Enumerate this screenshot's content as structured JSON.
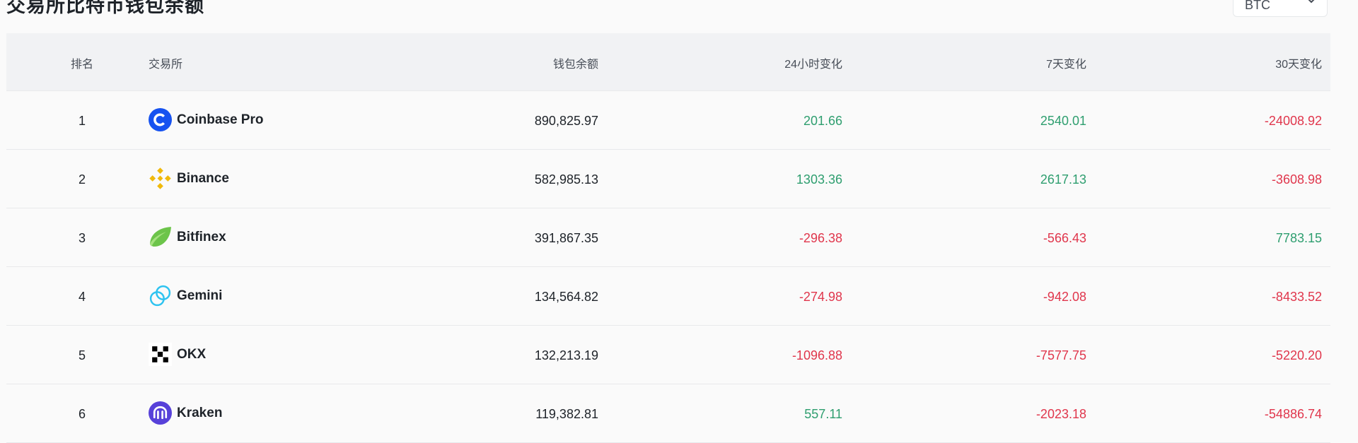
{
  "page": {
    "title": "交易所比特币钱包余额"
  },
  "currency_select": {
    "value": "BTC"
  },
  "colors": {
    "positive": "#2e9e6f",
    "negative": "#e0364c"
  },
  "table": {
    "headers": {
      "rank": "排名",
      "exchange": "交易所",
      "balance": "钱包余额",
      "change_24h": "24小时变化",
      "change_7d": "7天变化",
      "change_30d": "30天变化"
    },
    "rows": [
      {
        "rank": "1",
        "exchange": "Coinbase Pro",
        "logo": "coinbase-logo-icon",
        "balance": "890,825.97",
        "change_24h": "201.66",
        "change_7d": "2540.01",
        "change_30d": "-24008.92"
      },
      {
        "rank": "2",
        "exchange": "Binance",
        "logo": "binance-logo-icon",
        "balance": "582,985.13",
        "change_24h": "1303.36",
        "change_7d": "2617.13",
        "change_30d": "-3608.98"
      },
      {
        "rank": "3",
        "exchange": "Bitfinex",
        "logo": "bitfinex-logo-icon",
        "balance": "391,867.35",
        "change_24h": "-296.38",
        "change_7d": "-566.43",
        "change_30d": "7783.15"
      },
      {
        "rank": "4",
        "exchange": "Gemini",
        "logo": "gemini-logo-icon",
        "balance": "134,564.82",
        "change_24h": "-274.98",
        "change_7d": "-942.08",
        "change_30d": "-8433.52"
      },
      {
        "rank": "5",
        "exchange": "OKX",
        "logo": "okx-logo-icon",
        "balance": "132,213.19",
        "change_24h": "-1096.88",
        "change_7d": "-7577.75",
        "change_30d": "-5220.20"
      },
      {
        "rank": "6",
        "exchange": "Kraken",
        "logo": "kraken-logo-icon",
        "balance": "119,382.81",
        "change_24h": "557.11",
        "change_7d": "-2023.18",
        "change_30d": "-54886.74"
      }
    ]
  }
}
